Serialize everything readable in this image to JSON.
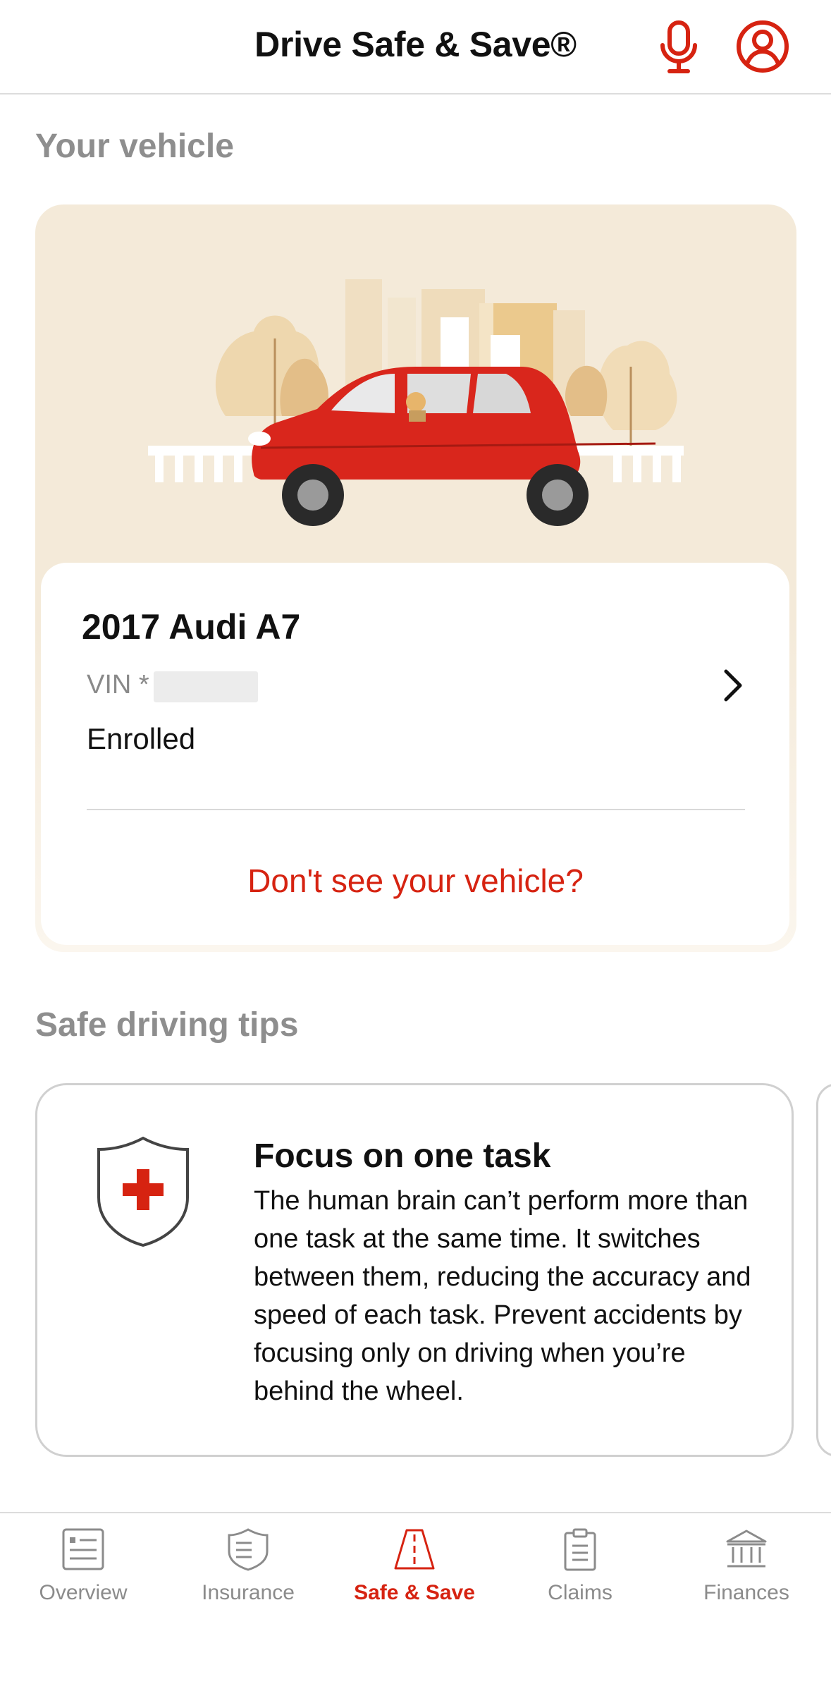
{
  "header": {
    "title": "Drive Safe & Save®",
    "mic_icon": "microphone-icon",
    "profile_icon": "user-circle-icon",
    "accent": "#d62311"
  },
  "vehicle_section": {
    "title": "Your vehicle",
    "vehicle": {
      "name": "2017 Audi A7",
      "vin_label": "VIN *",
      "status": "Enrolled"
    },
    "missing_link": "Don't see your vehicle?"
  },
  "tips_section": {
    "title": "Safe driving tips",
    "tip": {
      "icon": "shield-cross-icon",
      "title": "Focus on one task",
      "body": "The human brain can’t perform more than one task at the same time. It switches between them, reducing the accuracy and speed of each task. Prevent accidents by focusing only on driving when you’re behind the wheel."
    }
  },
  "nav": {
    "items": [
      {
        "label": "Overview",
        "icon": "overview-list-icon"
      },
      {
        "label": "Insurance",
        "icon": "insurance-shield-icon"
      },
      {
        "label": "Safe & Save",
        "icon": "road-icon",
        "active": true
      },
      {
        "label": "Claims",
        "icon": "clipboard-icon"
      },
      {
        "label": "Finances",
        "icon": "bank-icon"
      }
    ]
  }
}
